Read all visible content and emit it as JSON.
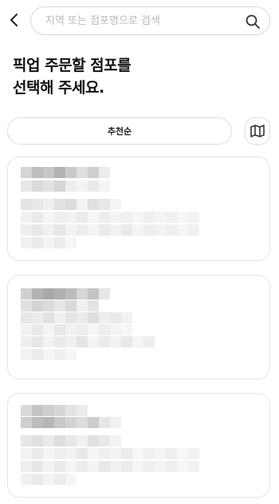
{
  "header": {
    "search_placeholder": "지역 또는 점포명으로 검색"
  },
  "page": {
    "title_line1": "픽업 주문할 점포를",
    "title_line2": "선택해 주세요."
  },
  "sort": {
    "selected_label": "추천순"
  },
  "icons": {
    "back": "chevron-left-icon",
    "search": "search-icon",
    "map": "map-icon"
  },
  "colors": {
    "border": "#dcdcdc",
    "text": "#111111",
    "placeholder": "#b8b8b8"
  }
}
